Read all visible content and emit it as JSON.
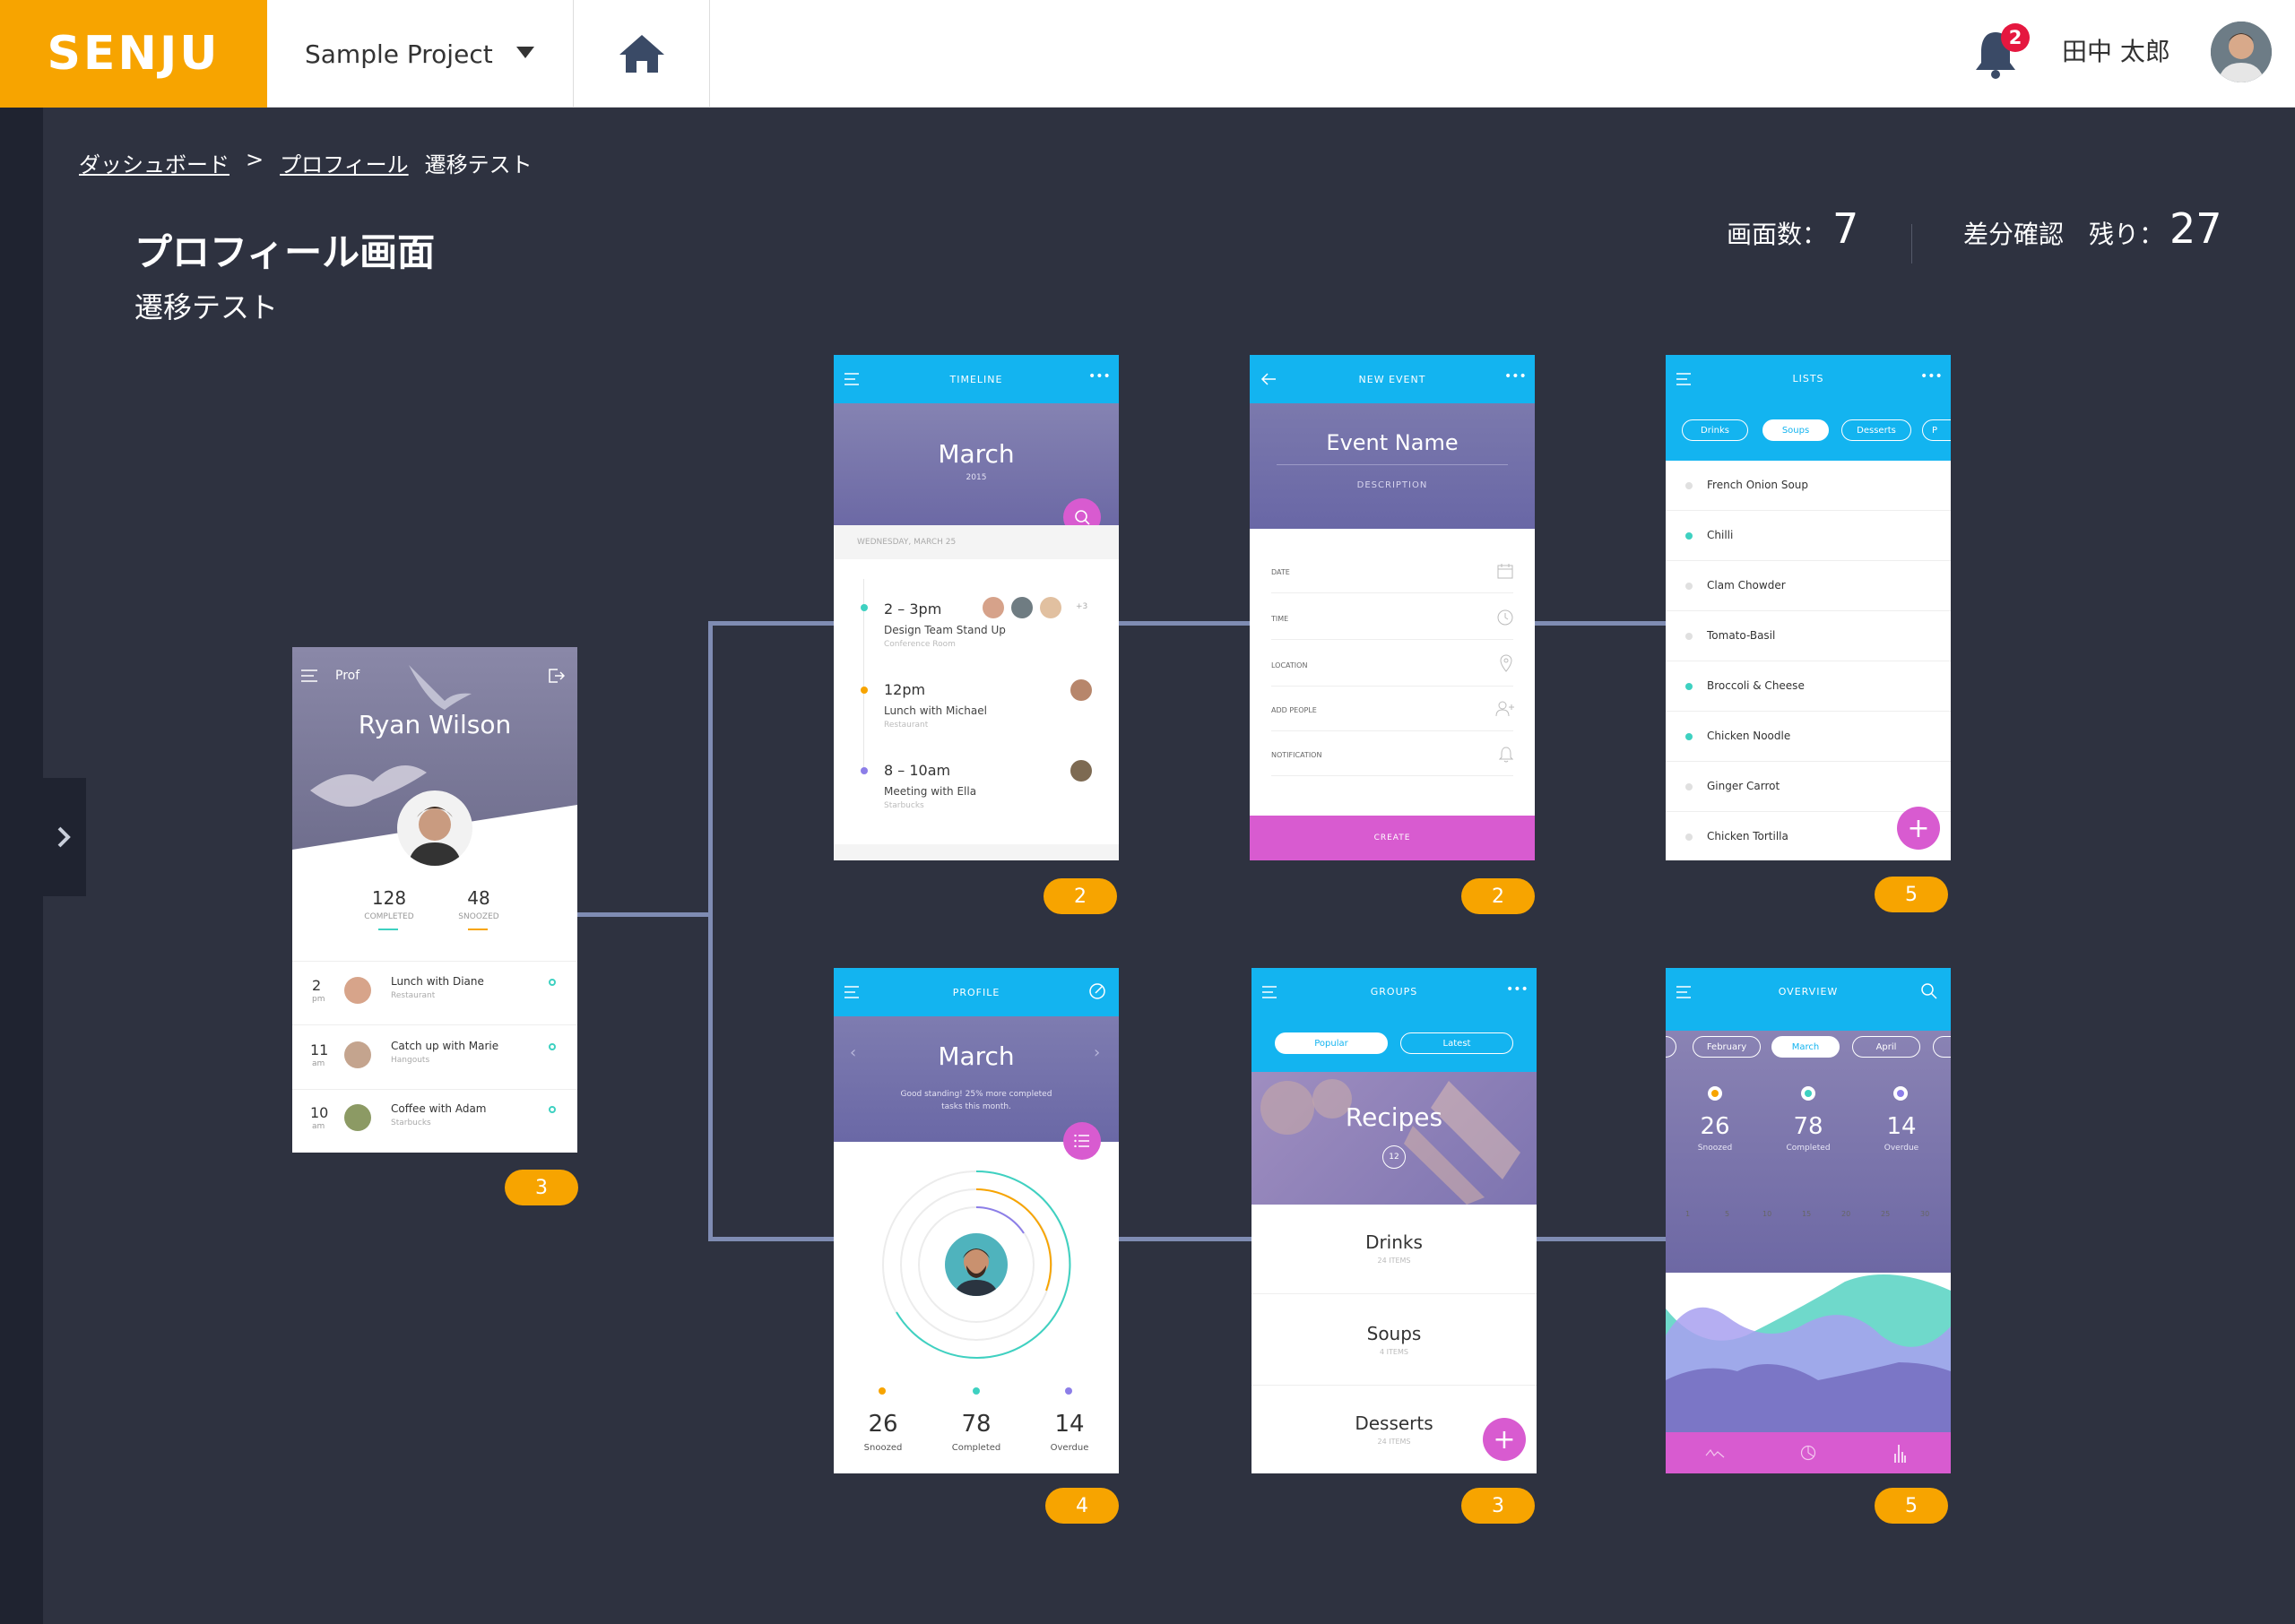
{
  "header": {
    "logo": "SENJU",
    "project": "Sample Project",
    "notification_count": "2",
    "user_name": "田中 太郎",
    "brand_color": "#f7a400"
  },
  "breadcrumb": {
    "dashboard": "ダッシュボード",
    "separator": ">",
    "profile": "プロフィール",
    "current": "遷移テスト"
  },
  "page": {
    "title": "プロフィール画面",
    "subtitle": "遷移テスト"
  },
  "stats": {
    "screens_label": "画面数：",
    "screens_value": "7",
    "diff_label": "差分確認　残り：",
    "diff_value": "27"
  },
  "screens": {
    "profile_start": {
      "menu": "Prof",
      "name": "Ryan Wilson",
      "completed": "128",
      "completed_label": "COMPLETED",
      "snoozed": "48",
      "snoozed_label": "SNOOZED",
      "items": [
        {
          "num": "2",
          "unit": "pm",
          "title": "Lunch with Diane",
          "sub": "Restaurant"
        },
        {
          "num": "11",
          "unit": "am",
          "title": "Catch up with Marie",
          "sub": "Hangouts"
        },
        {
          "num": "10",
          "unit": "am",
          "title": "Coffee with Adam",
          "sub": "Starbucks"
        }
      ],
      "count": "3"
    },
    "timeline": {
      "bar_title": "TIMELINE",
      "month": "March",
      "year": "2015",
      "date_header": "WEDNESDAY, MARCH 25",
      "extra": "+3",
      "events": [
        {
          "time": "2 – 3pm",
          "title": "Design Team Stand Up",
          "place": "Conference Room",
          "color": "#3ed1c1"
        },
        {
          "time": "12pm",
          "title": "Lunch with Michael",
          "place": "Restaurant",
          "color": "#f7a400"
        },
        {
          "time": "8 – 10am",
          "title": "Meeting with Ella",
          "place": "Starbucks",
          "color": "#8c7ee8"
        }
      ],
      "count": "2"
    },
    "new_event": {
      "bar_title": "NEW EVENT",
      "name": "Event Name",
      "description": "DESCRIPTION",
      "fields": [
        "DATE",
        "TIME",
        "LOCATION",
        "ADD PEOPLE",
        "NOTIFICATION"
      ],
      "create": "CREATE",
      "count": "2"
    },
    "lists": {
      "bar_title": "LISTS",
      "tabs": [
        "Drinks",
        "Soups",
        "Desserts",
        "P"
      ],
      "items": [
        {
          "label": "French Onion Soup",
          "color": "#e0e0e0"
        },
        {
          "label": "Chilli",
          "color": "#3ed1c1"
        },
        {
          "label": "Clam Chowder",
          "color": "#e0e0e0"
        },
        {
          "label": "Tomato-Basil",
          "color": "#e0e0e0"
        },
        {
          "label": "Broccoli & Cheese",
          "color": "#3ed1c1"
        },
        {
          "label": "Chicken Noodle",
          "color": "#3ed1c1"
        },
        {
          "label": "Ginger Carrot",
          "color": "#e0e0e0"
        },
        {
          "label": "Chicken Tortilla",
          "color": "#e0e0e0"
        }
      ],
      "count": "5"
    },
    "profile": {
      "bar_title": "PROFILE",
      "month": "March",
      "message_line1": "Good standing! 25% more completed",
      "message_line2": "tasks this month.",
      "stats": [
        {
          "value": "26",
          "label": "Snoozed",
          "color": "#f7a400"
        },
        {
          "value": "78",
          "label": "Completed",
          "color": "#3ed1c1"
        },
        {
          "value": "14",
          "label": "Overdue",
          "color": "#8c7ee8"
        }
      ],
      "count": "4"
    },
    "groups": {
      "bar_title": "GROUPS",
      "tabs": [
        "Popular",
        "Latest"
      ],
      "hero": "Recipes",
      "hero_badge": "12",
      "items": [
        {
          "label": "Drinks",
          "sub": "24 ITEMS"
        },
        {
          "label": "Soups",
          "sub": "4 ITEMS"
        },
        {
          "label": "Desserts",
          "sub": "24 ITEMS"
        }
      ],
      "count": "3"
    },
    "overview": {
      "bar_title": "OVERVIEW",
      "tabs": [
        "February",
        "March",
        "April"
      ],
      "stats": [
        {
          "value": "26",
          "label": "Snoozed",
          "color": "#f7a400"
        },
        {
          "value": "78",
          "label": "Completed",
          "color": "#3ed1c1"
        },
        {
          "value": "14",
          "label": "Overdue",
          "color": "#8c7ee8"
        }
      ],
      "axis": [
        "1",
        "5",
        "10",
        "15",
        "20",
        "25",
        "30"
      ],
      "count": "5"
    }
  }
}
